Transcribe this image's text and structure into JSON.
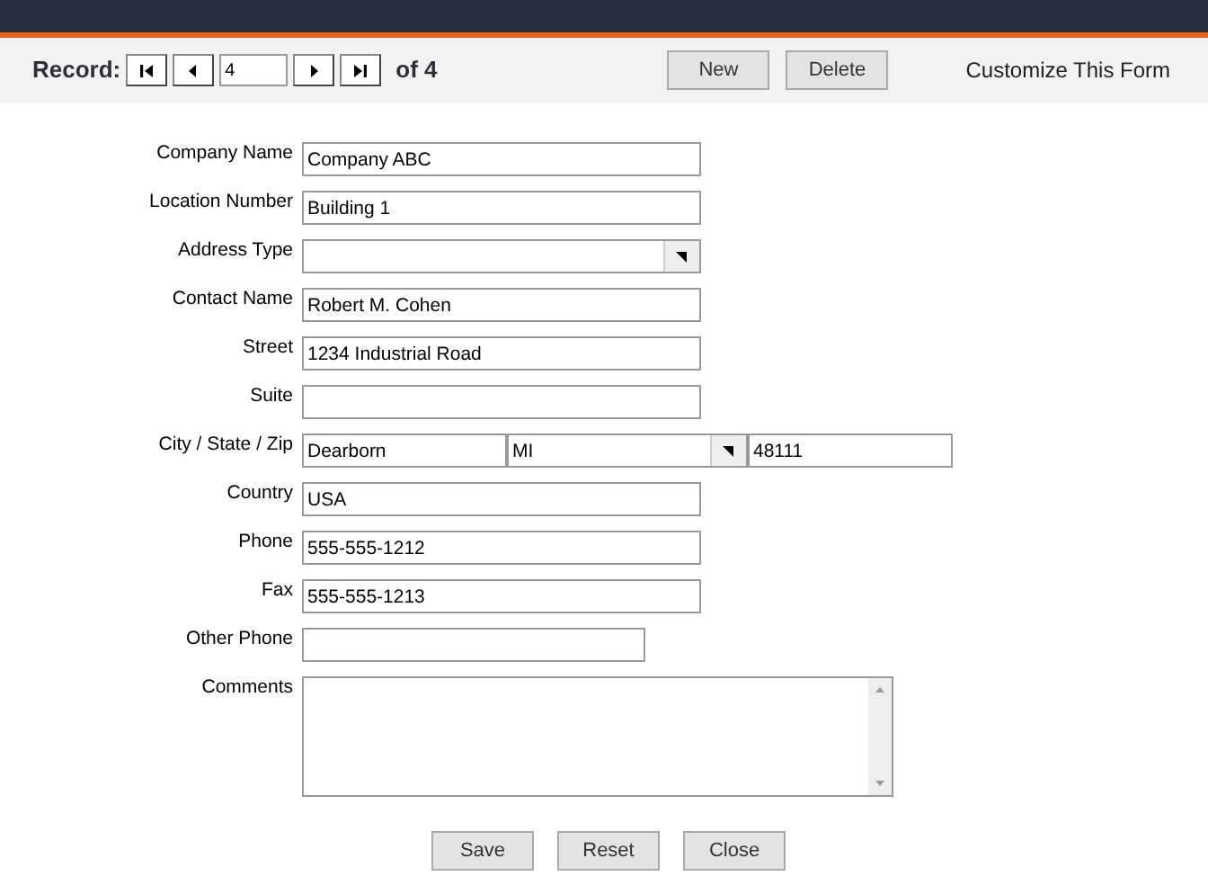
{
  "navigator": {
    "label": "Record:",
    "current": "4",
    "total": "of 4"
  },
  "toolbar_buttons": [
    "New",
    "Delete"
  ],
  "customize_link": "Customize This Form",
  "fields": [
    {
      "label": "Company Name",
      "inputs": [
        {
          "kind": "text",
          "value": "Company ABC"
        }
      ]
    },
    {
      "label": "Location Number",
      "inputs": [
        {
          "kind": "text",
          "value": "Building 1"
        }
      ]
    },
    {
      "label": "Address Type",
      "inputs": [
        {
          "kind": "select"
        }
      ]
    },
    {
      "label": "Contact Name",
      "inputs": [
        {
          "kind": "text",
          "value": "Robert M. Cohen"
        }
      ]
    },
    {
      "label": "Street",
      "inputs": [
        {
          "kind": "text",
          "value": "1234 Industrial Road"
        }
      ]
    },
    {
      "label": "Suite",
      "inputs": [
        {
          "kind": "text"
        }
      ]
    },
    {
      "label": "City / State / Zip",
      "inputs": [
        {
          "kind": "part-text",
          "value": "Dearborn"
        },
        {
          "kind": "part-select",
          "value": "MI"
        },
        {
          "kind": "part-text",
          "value": "48111"
        }
      ]
    },
    {
      "label": "Country",
      "inputs": [
        {
          "kind": "text",
          "value": "USA"
        }
      ]
    },
    {
      "label": "Phone",
      "inputs": [
        {
          "kind": "text",
          "value": "555-555-1212"
        }
      ]
    },
    {
      "label": "Fax",
      "inputs": [
        {
          "kind": "text",
          "value": "555-555-1213"
        }
      ]
    },
    {
      "label": "Other Phone",
      "inputs": [
        {
          "kind": "short-text"
        }
      ]
    },
    {
      "label": "Comments",
      "inputs": [
        {
          "kind": "textarea"
        }
      ]
    }
  ],
  "form_buttons": [
    "Save",
    "Reset",
    "Close"
  ]
}
